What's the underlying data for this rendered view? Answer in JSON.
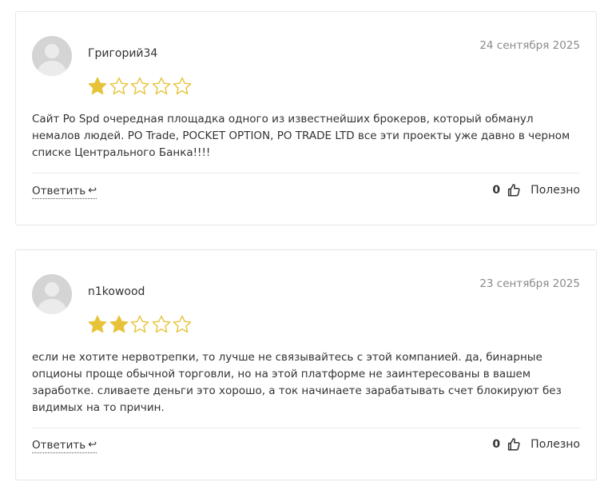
{
  "colors": {
    "star_filled": "#e7c33a",
    "star_outline": "#e7c33a",
    "date_text": "#8a8a8a",
    "border": "#e6e6e6"
  },
  "reviews": [
    {
      "author": "Григорий34",
      "date": "24 сентября 2025",
      "rating": 1,
      "rating_max": 5,
      "text": "Сайт Po Spd очередная площадка одного из известнейших брокеров, который обманул немалов людей. PO Trade, POCKET OPTION, PO TRADE LTD все эти проекты уже давно в черном списке Центрального Банка!!!!",
      "reply_label": "Ответить",
      "reply_icon": "↩",
      "helpful_count": "0",
      "helpful_label": "Полезно"
    },
    {
      "author": "n1kowood",
      "date": "23 сентября 2025",
      "rating": 2,
      "rating_max": 5,
      "text": "если не хотите нервотрепки, то лучше не связывайтесь с этой компанией. да, бинарные опционы проще обычной торговли, но на этой платформе не заинтересованы в вашем заработке. сливаете деньги это хорошо, а ток начинаете зарабатывать счет блокируют без видимых на то причин.",
      "reply_label": "Ответить",
      "reply_icon": "↩",
      "helpful_count": "0",
      "helpful_label": "Полезно"
    }
  ]
}
